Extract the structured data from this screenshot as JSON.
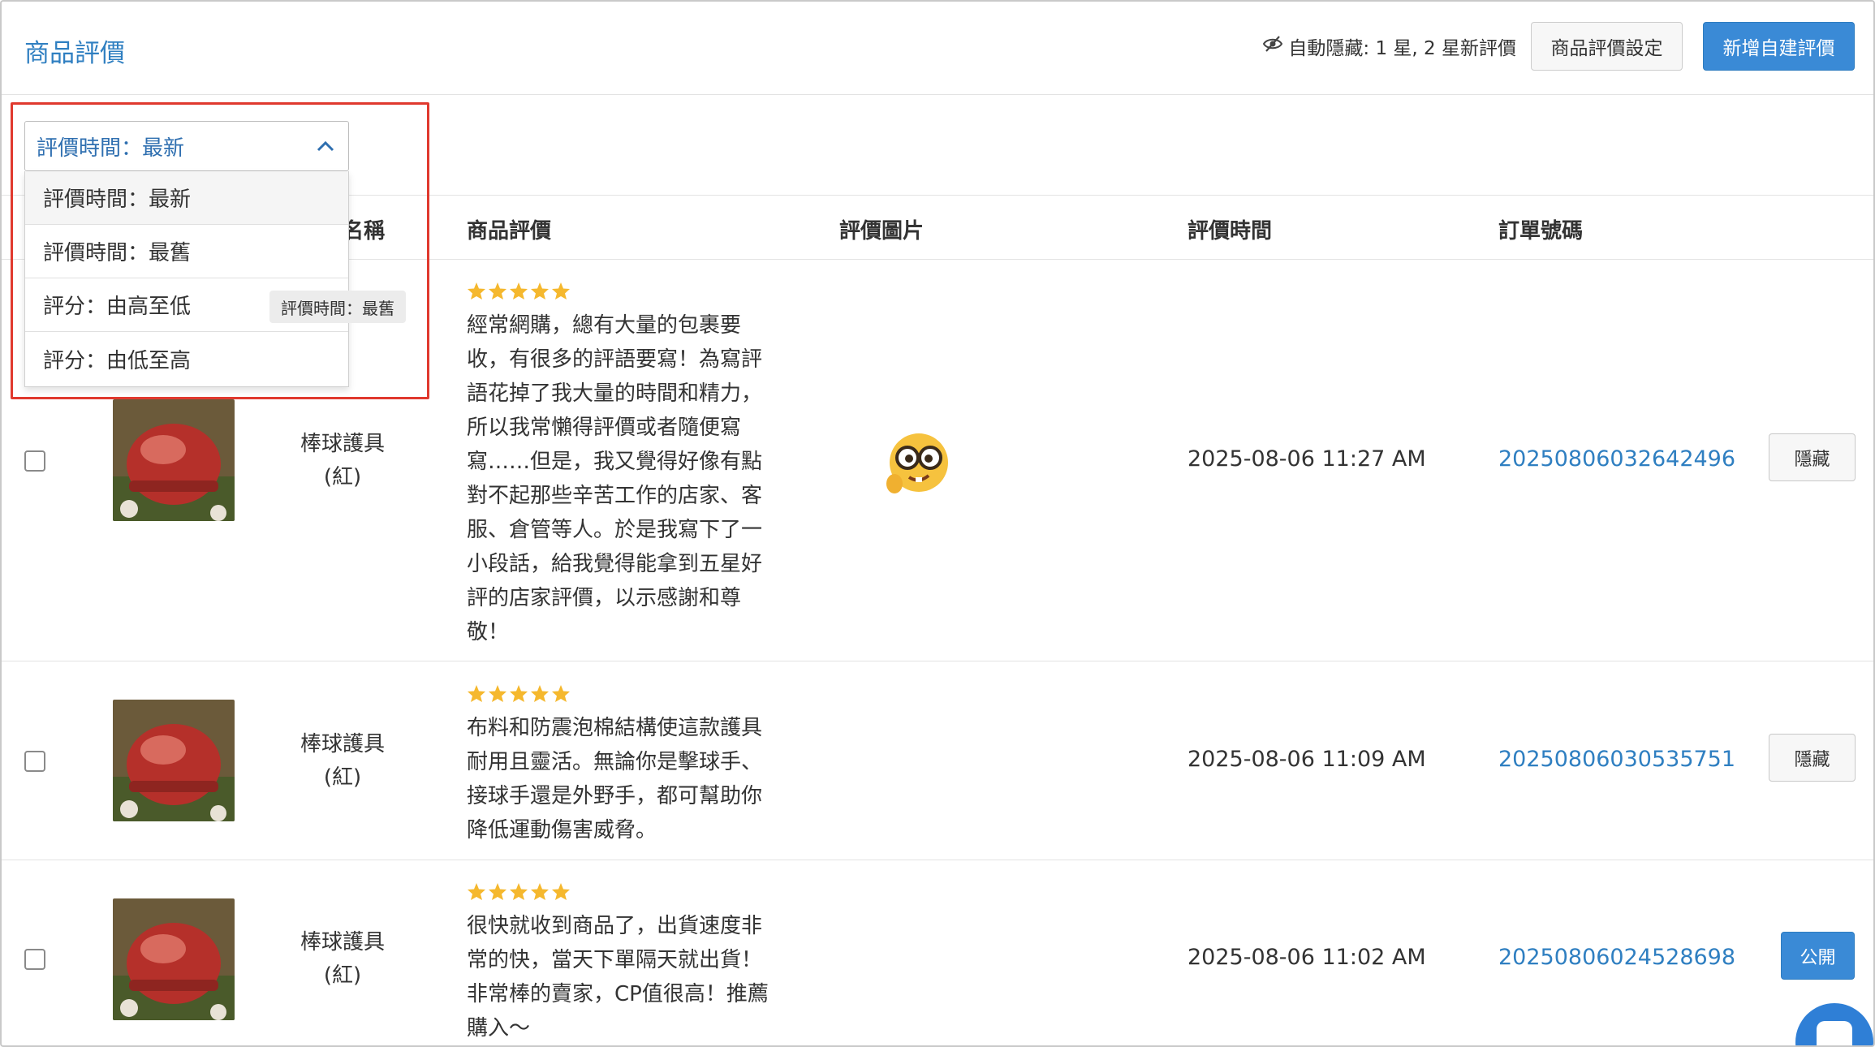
{
  "header": {
    "title": "商品評價",
    "auto_hide_text": "自動隱藏: 1 星, 2 星新評價",
    "settings_button": "商品評價設定",
    "add_button": "新增自建評價"
  },
  "sort": {
    "selected": "評價時間：最新",
    "options": [
      "評價時間：最新",
      "評價時間：最舊",
      "評分：由高至低",
      "評分：由低至高"
    ],
    "tooltip": "評價時間：最舊"
  },
  "table": {
    "headers": {
      "product_name_partial": "名稱",
      "review": "商品評價",
      "review_image": "評價圖片",
      "review_time": "評價時間",
      "order_no": "訂單號碼"
    },
    "rows": [
      {
        "product": "棒球護具",
        "variant": "(紅)",
        "rating": 5,
        "review_lines": [
          "經常網購，總有大量的包裹要",
          "收，有很多的評語要寫！為寫評",
          "語花掉了我大量的時間和精力，",
          "所以我常懶得評價或者隨便寫",
          "寫……但是，我又覺得好像有點",
          "對不起那些辛苦工作的店家、客",
          "服、倉管等人。於是我寫下了一",
          "小段話，給我覺得能拿到五星好",
          "評的店家評價，以示感謝和尊",
          "敬！"
        ],
        "image_icon": "nerd-face-emoji",
        "time": "2025-08-06 11:27 AM",
        "order": "20250806032642496",
        "action": "隱藏"
      },
      {
        "product": "棒球護具",
        "variant": "(紅)",
        "rating": 5,
        "review_lines": [
          "布料和防震泡棉結構使這款護具",
          "耐用且靈活。無論你是擊球手、",
          "接球手還是外野手，都可幫助你",
          "降低運動傷害威脅。"
        ],
        "time": "2025-08-06 11:09 AM",
        "order": "20250806030535751",
        "action": "隱藏"
      },
      {
        "product": "棒球護具",
        "variant": "(紅)",
        "rating": 5,
        "review_lines": [
          "很快就收到商品了，出貨速度非",
          "常的快，當天下單隔天就出貨！",
          "非常棒的賣家，CP值很高！推薦",
          "購入～"
        ],
        "time": "2025-08-06 11:02 AM",
        "order": "20250806024528698",
        "action": "公開"
      }
    ]
  },
  "colors": {
    "accent": "#2f7fc1",
    "primary_button": "#3a8ad6",
    "star": "#f5b82e",
    "highlight_border": "#e0392e"
  }
}
